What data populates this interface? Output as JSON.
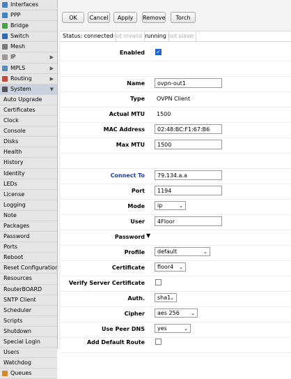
{
  "sidebar": {
    "items": [
      {
        "label": "Interfaces",
        "icon": "interfaces-icon",
        "color": "#4a7fc1"
      },
      {
        "label": "PPP",
        "icon": "ppp-icon",
        "color": "#3b86c6"
      },
      {
        "label": "Bridge",
        "icon": "bridge-icon",
        "color": "#4aa04a"
      },
      {
        "label": "Switch",
        "icon": "switch-icon",
        "color": "#2e6bb5"
      },
      {
        "label": "Mesh",
        "icon": "mesh-icon",
        "color": "#7a7a7a"
      },
      {
        "label": "IP",
        "icon": "ip-icon",
        "color": "#9a9a9a",
        "arrow": "▶"
      },
      {
        "label": "MPLS",
        "icon": "mpls-icon",
        "color": "#5a8ab5",
        "arrow": "▶"
      },
      {
        "label": "Routing",
        "icon": "routing-icon",
        "color": "#c4473b",
        "arrow": "▶"
      },
      {
        "label": "System",
        "icon": "system-icon",
        "color": "#555",
        "arrow": "▼"
      },
      {
        "label": "Auto Upgrade"
      },
      {
        "label": "Certificates"
      },
      {
        "label": "Clock"
      },
      {
        "label": "Console"
      },
      {
        "label": "Disks"
      },
      {
        "label": "Health"
      },
      {
        "label": "History"
      },
      {
        "label": "Identity"
      },
      {
        "label": "LEDs"
      },
      {
        "label": "License"
      },
      {
        "label": "Logging"
      },
      {
        "label": "Note"
      },
      {
        "label": "Packages"
      },
      {
        "label": "Password"
      },
      {
        "label": "Ports"
      },
      {
        "label": "Reboot"
      },
      {
        "label": "Reset Configuration"
      },
      {
        "label": "Resources"
      },
      {
        "label": "RouterBOARD"
      },
      {
        "label": "SNTP Client"
      },
      {
        "label": "Scheduler"
      },
      {
        "label": "Scripts"
      },
      {
        "label": "Shutdown"
      },
      {
        "label": "Special Login"
      },
      {
        "label": "Users"
      },
      {
        "label": "Watchdog"
      },
      {
        "label": "Queues",
        "icon": "queues-icon",
        "color": "#d6892a"
      }
    ]
  },
  "toolbar": {
    "ok": "OK",
    "cancel": "Cancel",
    "apply": "Apply",
    "remove": "Remove",
    "torch": "Torch"
  },
  "status": {
    "state": "Status: connected",
    "invalid": "not invalid",
    "running": "running",
    "slave": "not slave"
  },
  "form": {
    "enabled_label": "Enabled",
    "name_label": "Name",
    "name_value": "ovpn-out1",
    "type_label": "Type",
    "type_value": "OVPN Client",
    "actual_mtu_label": "Actual MTU",
    "actual_mtu_value": "1500",
    "mac_label": "MAC Address",
    "mac_value": "02:48:BC:F1:67:B6",
    "max_mtu_label": "Max MTU",
    "max_mtu_value": "1500",
    "connect_to_label": "Connect To",
    "connect_to_value": "79.134.a.a",
    "port_label": "Port",
    "port_value": "1194",
    "mode_label": "Mode",
    "mode_value": "ip",
    "user_label": "User",
    "user_value": "4Floor",
    "password_label": "Password",
    "profile_label": "Profile",
    "profile_value": "default",
    "certificate_label": "Certificate",
    "certificate_value": "floor4",
    "verify_label": "Verify Server Certificate",
    "auth_label": "Auth.",
    "auth_value": "sha1",
    "cipher_label": "Cipher",
    "cipher_value": "aes 256",
    "peer_dns_label": "Use Peer DNS",
    "peer_dns_value": "yes",
    "default_route_label": "Add Default Route"
  }
}
